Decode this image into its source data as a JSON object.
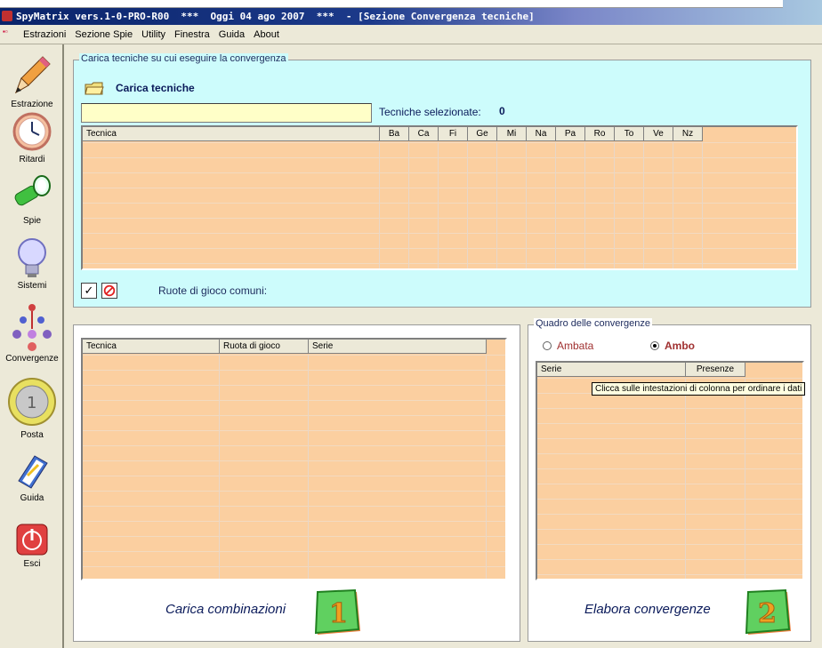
{
  "window": {
    "title": "SpyMatrix vers.1-0-PRO-R00  ***  Oggi 04 ago 2007  ***  - [Sezione Convergenza tecniche]"
  },
  "menu": [
    "Estrazioni",
    "Sezione Spie",
    "Utility",
    "Finestra",
    "Guida",
    "About"
  ],
  "sidebar": {
    "items": [
      {
        "label": "Estrazione",
        "icon": "pencil-icon"
      },
      {
        "label": "Ritardi",
        "icon": "clock-icon"
      },
      {
        "label": "Spie",
        "icon": "flashlight-icon"
      },
      {
        "label": "Sistemi",
        "icon": "lightbulb-icon"
      },
      {
        "label": "Convergenze",
        "icon": "convergence-icon"
      },
      {
        "label": "Posta",
        "icon": "euro-coin-icon"
      },
      {
        "label": "Guida",
        "icon": "book-icon"
      },
      {
        "label": "Esci",
        "icon": "power-icon"
      }
    ]
  },
  "load_section": {
    "title": "Carica tecniche su cui eseguire la convergenza",
    "load_label": "Carica tecniche",
    "input_value": "",
    "selected_label": "Tecniche selezionate:",
    "selected_count": "0",
    "columns": [
      "Tecnica",
      "Ba",
      "Ca",
      "Fi",
      "Ge",
      "Mi",
      "Na",
      "Pa",
      "Ro",
      "To",
      "Ve",
      "Nz"
    ],
    "common_wheels_label": "Ruote di gioco comuni:"
  },
  "combinations": {
    "columns": [
      "Tecnica",
      "Ruota di gioco",
      "Serie"
    ],
    "button_label": "Carica combinazioni",
    "button_number": "1"
  },
  "convergence": {
    "title": "Quadro delle convergenze",
    "radio_ambata": "Ambata",
    "radio_ambo": "Ambo",
    "selected": "Ambo",
    "columns": [
      "Serie",
      "Presenze"
    ],
    "tooltip": "Clicca sulle intestazioni di colonna per ordinare i dati",
    "button_label": "Elabora convergenze",
    "button_number": "2"
  },
  "colors": {
    "panel_cyan": "#cdfcfc",
    "grid_peach": "#fbcfa0",
    "title_navy": "#0a246a"
  }
}
